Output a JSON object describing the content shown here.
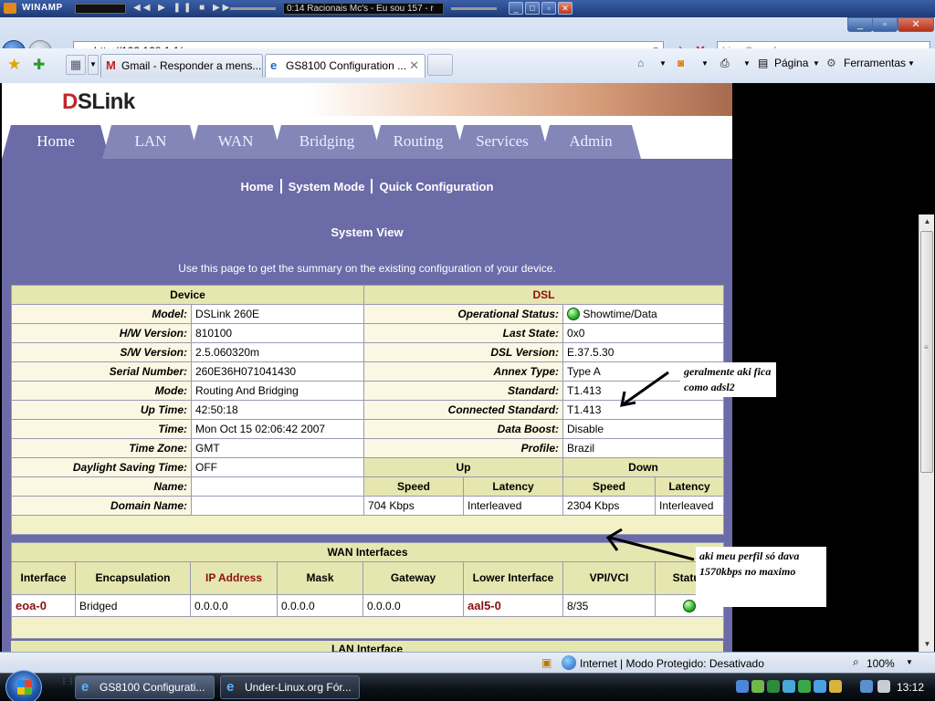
{
  "winamp": {
    "title": "WINAMP",
    "controls": "◀◀ ▶ ❚❚ ■ ▶▶",
    "track_display": "0:14  Racionais Mc's - Eu sou 157 - r"
  },
  "ie": {
    "address": "http://192.168.1.1/",
    "search_placeholder": "Live Search",
    "tabs": [
      {
        "label": "Gmail - Responder a mens..."
      },
      {
        "label": "GS8100 Configuration ..."
      }
    ],
    "commands": {
      "page_label": "Página",
      "tools_label": "Ferramentas"
    }
  },
  "router": {
    "logo_prefix": "D",
    "logo_suffix": "SLink",
    "nav_tabs": [
      "Home",
      "LAN",
      "WAN",
      "Bridging",
      "Routing",
      "Services",
      "Admin"
    ],
    "breadcrumbs": [
      "Home",
      "System Mode",
      "Quick Configuration"
    ],
    "title": "System View",
    "description": "Use this page to get the summary on the existing configuration of your device.",
    "device_header": "Device",
    "dsl_header": "DSL",
    "device_rows": [
      {
        "label": "Model:",
        "value": "DSLink 260E"
      },
      {
        "label": "H/W Version:",
        "value": "810100"
      },
      {
        "label": "S/W Version:",
        "value": "2.5.060320m"
      },
      {
        "label": "Serial Number:",
        "value": "260E36H071041430"
      },
      {
        "label": "Mode:",
        "value": "Routing And Bridging"
      },
      {
        "label": "Up Time:",
        "value": "42:50:18"
      },
      {
        "label": "Time:",
        "value": "Mon Oct 15 02:06:42 2007"
      },
      {
        "label": "Time Zone:",
        "value": "GMT"
      },
      {
        "label": "Daylight Saving Time:",
        "value": "OFF"
      },
      {
        "label": "Name:",
        "value": ""
      },
      {
        "label": "Domain Name:",
        "value": ""
      }
    ],
    "dsl_rows": [
      {
        "label": "Operational Status:",
        "value": "Showtime/Data"
      },
      {
        "label": "Last State:",
        "value": "0x0"
      },
      {
        "label": "DSL Version:",
        "value": "E.37.5.30"
      },
      {
        "label": "Annex Type:",
        "value": "Type A"
      },
      {
        "label": "Standard:",
        "value": "T1.413"
      },
      {
        "label": "Connected Standard:",
        "value": "T1.413"
      },
      {
        "label": "Data Boost:",
        "value": "Disable"
      },
      {
        "label": "Profile:",
        "value": "Brazil"
      }
    ],
    "rate_headers": {
      "up": "Up",
      "down": "Down",
      "speed": "Speed",
      "latency": "Latency"
    },
    "rates": {
      "up_speed": "704 Kbps",
      "up_latency": "Interleaved",
      "down_speed": "2304 Kbps",
      "down_latency": "Interleaved"
    },
    "wan": {
      "title": "WAN Interfaces",
      "columns": [
        "Interface",
        "Encapsulation",
        "IP Address",
        "Mask",
        "Gateway",
        "Lower Interface",
        "VPI/VCI",
        "Status"
      ],
      "rows": [
        {
          "interface": "eoa-0",
          "encapsulation": "Bridged",
          "ip": "0.0.0.0",
          "mask": "0.0.0.0",
          "gateway": "0.0.0.0",
          "lower": "aal5-0",
          "vpi_vci": "8/35"
        }
      ]
    },
    "lan_title": "LAN Interface"
  },
  "annotations": {
    "standard_note": "geralmente aki fica como adsl2",
    "rate_note": "aki meu perfil só dava 1570kbps no maximo"
  },
  "statusbar": {
    "zone": "Internet | Modo Protegido: Desativado",
    "zoom": "100%"
  },
  "taskbar": {
    "tasks": [
      {
        "label": "GS8100 Configurati..."
      },
      {
        "label": "Under-Linux.org Fór..."
      }
    ],
    "clock": "13:12"
  },
  "colors": {
    "content_bg": "#6b6ba8",
    "table_header_bg": "#e6e6b0",
    "label_bg": "#fbf7e2",
    "accent_red": "#8a0f0f",
    "status_green": "#2db12d"
  }
}
